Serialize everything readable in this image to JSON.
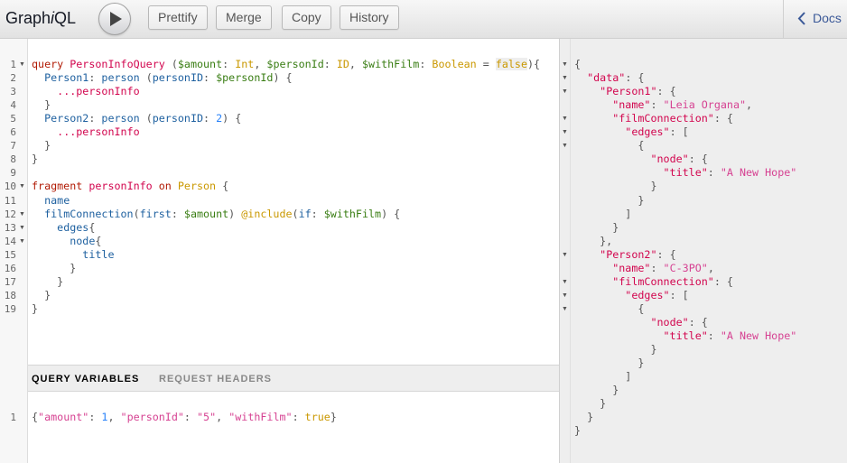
{
  "header": {
    "title_prefix": "Graph",
    "title_italic": "i",
    "title_suffix": "QL",
    "buttons": {
      "prettify": "Prettify",
      "merge": "Merge",
      "copy": "Copy",
      "history": "History"
    },
    "docs_label": "Docs"
  },
  "variables_tabs": {
    "query_variables": "QUERY VARIABLES",
    "request_headers": "REQUEST HEADERS"
  },
  "query_lines": [
    [
      [
        "kw",
        "query "
      ],
      [
        "def",
        "PersonInfoQuery"
      ],
      [
        "punct",
        " ("
      ],
      [
        "var",
        "$amount"
      ],
      [
        "punct",
        ": "
      ],
      [
        "type",
        "Int"
      ],
      [
        "punct",
        ", "
      ],
      [
        "var",
        "$personId"
      ],
      [
        "punct",
        ": "
      ],
      [
        "type",
        "ID"
      ],
      [
        "punct",
        ", "
      ],
      [
        "var",
        "$withFilm"
      ],
      [
        "punct",
        ": "
      ],
      [
        "type",
        "Boolean"
      ],
      [
        "punct",
        " = "
      ],
      [
        "bool hl",
        "false"
      ],
      [
        "punct",
        "){"
      ]
    ],
    [
      [
        "punct",
        "  "
      ],
      [
        "attr",
        "Person1"
      ],
      [
        "punct",
        ": "
      ],
      [
        "prop",
        "person"
      ],
      [
        "punct",
        " ("
      ],
      [
        "attr",
        "personID"
      ],
      [
        "punct",
        ": "
      ],
      [
        "var",
        "$personId"
      ],
      [
        "punct",
        ") {"
      ]
    ],
    [
      [
        "punct",
        "    "
      ],
      [
        "def",
        "...personInfo"
      ]
    ],
    [
      [
        "punct",
        "  }"
      ]
    ],
    [
      [
        "punct",
        "  "
      ],
      [
        "attr",
        "Person2"
      ],
      [
        "punct",
        ": "
      ],
      [
        "prop",
        "person"
      ],
      [
        "punct",
        " ("
      ],
      [
        "attr",
        "personID"
      ],
      [
        "punct",
        ": "
      ],
      [
        "num",
        "2"
      ],
      [
        "punct",
        ") {"
      ]
    ],
    [
      [
        "punct",
        "    "
      ],
      [
        "def",
        "...personInfo"
      ]
    ],
    [
      [
        "punct",
        "  }"
      ]
    ],
    [
      [
        "punct",
        "}"
      ]
    ],
    [],
    [
      [
        "kw",
        "fragment "
      ],
      [
        "def",
        "personInfo"
      ],
      [
        "kw",
        " on "
      ],
      [
        "type",
        "Person"
      ],
      [
        "punct",
        " {"
      ]
    ],
    [
      [
        "punct",
        "  "
      ],
      [
        "field",
        "name"
      ]
    ],
    [
      [
        "punct",
        "  "
      ],
      [
        "field",
        "filmConnection"
      ],
      [
        "punct",
        "("
      ],
      [
        "attr",
        "first"
      ],
      [
        "punct",
        ": "
      ],
      [
        "var",
        "$amount"
      ],
      [
        "punct",
        ") "
      ],
      [
        "type",
        "@include"
      ],
      [
        "punct",
        "("
      ],
      [
        "attr",
        "if"
      ],
      [
        "punct",
        ": "
      ],
      [
        "var",
        "$withFilm"
      ],
      [
        "punct",
        ") {"
      ]
    ],
    [
      [
        "punct",
        "    "
      ],
      [
        "field",
        "edges"
      ],
      [
        "punct",
        "{"
      ]
    ],
    [
      [
        "punct",
        "      "
      ],
      [
        "field",
        "node"
      ],
      [
        "punct",
        "{"
      ]
    ],
    [
      [
        "punct",
        "        "
      ],
      [
        "field",
        "title"
      ]
    ],
    [
      [
        "punct",
        "      }"
      ]
    ],
    [
      [
        "punct",
        "    }"
      ]
    ],
    [
      [
        "punct",
        "  }"
      ]
    ],
    [
      [
        "punct",
        "}"
      ]
    ]
  ],
  "query_folds": [
    1,
    10,
    12,
    13,
    14
  ],
  "variables_line": [
    [
      "punct",
      "{"
    ],
    [
      "str",
      "\"amount\""
    ],
    [
      "punct",
      ": "
    ],
    [
      "num",
      "1"
    ],
    [
      "punct",
      ", "
    ],
    [
      "str",
      "\"personId\""
    ],
    [
      "punct",
      ": "
    ],
    [
      "str",
      "\"5\""
    ],
    [
      "punct",
      ", "
    ],
    [
      "str",
      "\"withFilm\""
    ],
    [
      "punct",
      ": "
    ],
    [
      "bool",
      "true"
    ],
    [
      "punct",
      "}"
    ]
  ],
  "result_lines": [
    [
      [
        "punct",
        "{"
      ]
    ],
    [
      [
        "punct",
        "  "
      ],
      [
        "def",
        "\"data\""
      ],
      [
        "punct",
        ": {"
      ]
    ],
    [
      [
        "punct",
        "    "
      ],
      [
        "def",
        "\"Person1\""
      ],
      [
        "punct",
        ": {"
      ]
    ],
    [
      [
        "punct",
        "      "
      ],
      [
        "def",
        "\"name\""
      ],
      [
        "punct",
        ": "
      ],
      [
        "str",
        "\"Leia Organa\""
      ],
      [
        "punct",
        ","
      ]
    ],
    [
      [
        "punct",
        "      "
      ],
      [
        "def",
        "\"filmConnection\""
      ],
      [
        "punct",
        ": {"
      ]
    ],
    [
      [
        "punct",
        "        "
      ],
      [
        "def",
        "\"edges\""
      ],
      [
        "punct",
        ": ["
      ]
    ],
    [
      [
        "punct",
        "          {"
      ]
    ],
    [
      [
        "punct",
        "            "
      ],
      [
        "def",
        "\"node\""
      ],
      [
        "punct",
        ": {"
      ]
    ],
    [
      [
        "punct",
        "              "
      ],
      [
        "def",
        "\"title\""
      ],
      [
        "punct",
        ": "
      ],
      [
        "str",
        "\"A New Hope\""
      ]
    ],
    [
      [
        "punct",
        "            }"
      ]
    ],
    [
      [
        "punct",
        "          }"
      ]
    ],
    [
      [
        "punct",
        "        ]"
      ]
    ],
    [
      [
        "punct",
        "      }"
      ]
    ],
    [
      [
        "punct",
        "    },"
      ]
    ],
    [
      [
        "punct",
        "    "
      ],
      [
        "def",
        "\"Person2\""
      ],
      [
        "punct",
        ": {"
      ]
    ],
    [
      [
        "punct",
        "      "
      ],
      [
        "def",
        "\"name\""
      ],
      [
        "punct",
        ": "
      ],
      [
        "str",
        "\"C-3PO\""
      ],
      [
        "punct",
        ","
      ]
    ],
    [
      [
        "punct",
        "      "
      ],
      [
        "def",
        "\"filmConnection\""
      ],
      [
        "punct",
        ": {"
      ]
    ],
    [
      [
        "punct",
        "        "
      ],
      [
        "def",
        "\"edges\""
      ],
      [
        "punct",
        ": ["
      ]
    ],
    [
      [
        "punct",
        "          {"
      ]
    ],
    [
      [
        "punct",
        "            "
      ],
      [
        "def",
        "\"node\""
      ],
      [
        "punct",
        ": {"
      ]
    ],
    [
      [
        "punct",
        "              "
      ],
      [
        "def",
        "\"title\""
      ],
      [
        "punct",
        ": "
      ],
      [
        "str",
        "\"A New Hope\""
      ]
    ],
    [
      [
        "punct",
        "            }"
      ]
    ],
    [
      [
        "punct",
        "          }"
      ]
    ],
    [
      [
        "punct",
        "        ]"
      ]
    ],
    [
      [
        "punct",
        "      }"
      ]
    ],
    [
      [
        "punct",
        "    }"
      ]
    ],
    [
      [
        "punct",
        "  }"
      ]
    ],
    [
      [
        "punct",
        "}"
      ]
    ]
  ],
  "result_folds": [
    1,
    2,
    3,
    5,
    6,
    7,
    15,
    17,
    18,
    19
  ]
}
